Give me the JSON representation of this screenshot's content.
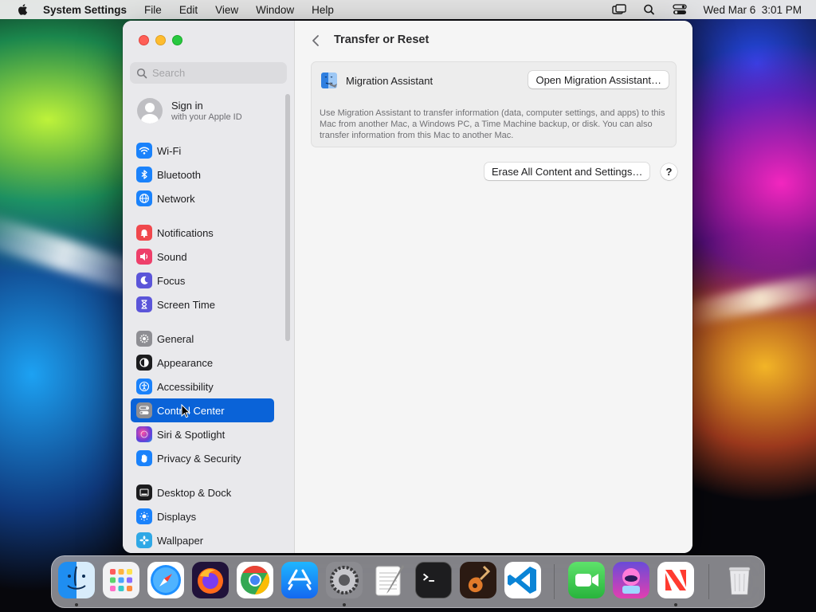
{
  "menubar": {
    "app_name": "System Settings",
    "menus": [
      "File",
      "Edit",
      "View",
      "Window",
      "Help"
    ],
    "clock": "Wed Mar 6  3:01 PM"
  },
  "search": {
    "placeholder": "Search"
  },
  "account": {
    "title": "Sign in",
    "subtitle": "with your Apple ID"
  },
  "sidebar": {
    "items": [
      {
        "label": "Wi-Fi",
        "icon": "wifi-icon",
        "color": "#1a82fb"
      },
      {
        "label": "Bluetooth",
        "icon": "bluetooth-icon",
        "color": "#1a82fb"
      },
      {
        "label": "Network",
        "icon": "globe-icon",
        "color": "#1a82fb"
      },
      {
        "label": "Notifications",
        "icon": "bell-icon",
        "color": "#f0484d"
      },
      {
        "label": "Sound",
        "icon": "speaker-icon",
        "color": "#ee3f6a"
      },
      {
        "label": "Focus",
        "icon": "moon-icon",
        "color": "#5b55d9"
      },
      {
        "label": "Screen Time",
        "icon": "hourglass-icon",
        "color": "#5b55d9"
      },
      {
        "label": "General",
        "icon": "gear-icon",
        "color": "#8e8e93"
      },
      {
        "label": "Appearance",
        "icon": "appearance-icon",
        "color": "#1c1c1e"
      },
      {
        "label": "Accessibility",
        "icon": "accessibility-icon",
        "color": "#1a82fb"
      },
      {
        "label": "Control Center",
        "icon": "toggles-icon",
        "color": "#8e8e93"
      },
      {
        "label": "Siri & Spotlight",
        "icon": "siri-icon",
        "color": "#b43ad6"
      },
      {
        "label": "Privacy & Security",
        "icon": "hand-icon",
        "color": "#1a82fb"
      },
      {
        "label": "Desktop & Dock",
        "icon": "dock-icon",
        "color": "#1c1c1e"
      },
      {
        "label": "Displays",
        "icon": "sun-icon",
        "color": "#1a82fb"
      },
      {
        "label": "Wallpaper",
        "icon": "flower-icon",
        "color": "#2fa8e6"
      }
    ],
    "selected": "Control Center"
  },
  "content": {
    "title": "Transfer or Reset",
    "migration": {
      "label": "Migration Assistant",
      "button": "Open Migration Assistant…",
      "description": "Use Migration Assistant to transfer information (data, computer settings, and apps) to this Mac from another Mac, a Windows PC, a Time Machine backup, or disk. You can also transfer information from this Mac to another Mac."
    },
    "erase_button": "Erase All Content and Settings…",
    "help_button": "?"
  },
  "dock": {
    "apps": [
      "Finder",
      "Launchpad",
      "Safari",
      "Firefox",
      "Chrome",
      "App Store",
      "System Settings",
      "TextEdit",
      "Terminal",
      "GarageBand",
      "Visual Studio Code",
      "FaceTime",
      "Alien App",
      "News",
      "Trash"
    ]
  },
  "colors": {
    "accent": "#0a63d8"
  }
}
